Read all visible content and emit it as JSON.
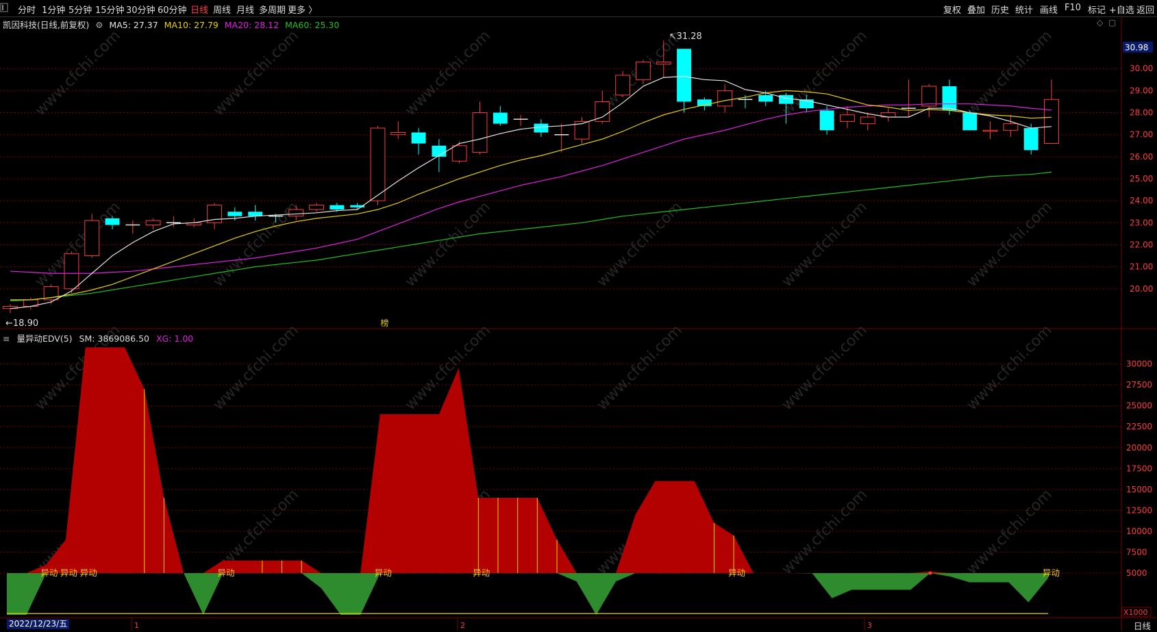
{
  "toolbar": {
    "periods": [
      "分时",
      "1分钟",
      "5分钟",
      "15分钟",
      "30分钟",
      "60分钟",
      "日线",
      "周线",
      "月线",
      "多周期",
      "更多 〉"
    ],
    "active_period": "日线",
    "right_buttons": [
      "复权",
      "叠加",
      "历史",
      "统计",
      "画线",
      "F10",
      "标记",
      "+自选",
      "返回"
    ]
  },
  "info": {
    "stock": "凯因科技(日线,前复权)",
    "ma5": "MA5: 27.37",
    "ma10": "MA10: 27.79",
    "ma20": "MA20: 28.12",
    "ma60": "MA60: 25.30"
  },
  "colors": {
    "up": "#ff3b3b",
    "down": "#00ffff",
    "ma5": "#e6e6e6",
    "ma10": "#e8d200",
    "ma20": "#e020e0",
    "ma60": "#20c020",
    "area_up": "#b30000",
    "area_down": "#2e8b2e",
    "grid": "#7a0000"
  },
  "price_axis": {
    "current_price": "30.98",
    "ticks": [
      "30.00",
      "29.00",
      "28.00",
      "27.00",
      "26.00",
      "25.00",
      "24.00",
      "23.00",
      "22.00",
      "21.00",
      "20.00"
    ],
    "high_label": "31.28",
    "low_label": "18.90"
  },
  "indicator": {
    "name": "量异动EDV(5)",
    "sm": "SM: 3869086.50",
    "xg": "XG: 1.00",
    "ticks": [
      "30000",
      "27500",
      "25000",
      "22500",
      "20000",
      "17500",
      "15000",
      "12500",
      "10000",
      "7500",
      "5000"
    ],
    "unit": "X1000",
    "signal_label": "异动",
    "event_label": "榜"
  },
  "bottom": {
    "date": "2022/12/23/五",
    "month_marks": [
      "1",
      "2",
      "3"
    ],
    "period": "日线"
  },
  "chart_data": {
    "type": "candlestick",
    "candles": [
      [
        19.1,
        19.2,
        19.3,
        18.9,
        "up"
      ],
      [
        19.2,
        19.5,
        19.6,
        19.05,
        "up"
      ],
      [
        19.5,
        20.1,
        20.2,
        19.3,
        "up"
      ],
      [
        20.0,
        21.6,
        21.7,
        19.8,
        "up"
      ],
      [
        21.5,
        23.1,
        23.4,
        21.4,
        "up"
      ],
      [
        23.2,
        22.9,
        23.3,
        22.7,
        "down"
      ],
      [
        22.9,
        22.9,
        23.1,
        22.5,
        "flat"
      ],
      [
        22.9,
        23.1,
        23.2,
        22.7,
        "up"
      ],
      [
        23.0,
        23.0,
        23.3,
        22.8,
        "flat"
      ],
      [
        22.9,
        23.0,
        23.2,
        22.8,
        "up"
      ],
      [
        23.0,
        23.8,
        23.9,
        22.7,
        "up"
      ],
      [
        23.5,
        23.3,
        23.7,
        23.1,
        "down"
      ],
      [
        23.5,
        23.3,
        23.8,
        23.1,
        "down"
      ],
      [
        23.3,
        23.2,
        23.4,
        23.0,
        "flat"
      ],
      [
        23.3,
        23.6,
        23.8,
        23.1,
        "up"
      ],
      [
        23.6,
        23.8,
        23.9,
        23.5,
        "up"
      ],
      [
        23.8,
        23.6,
        23.9,
        23.5,
        "down"
      ],
      [
        23.8,
        23.7,
        23.9,
        23.6,
        "down"
      ],
      [
        24.0,
        27.3,
        27.4,
        23.8,
        "up"
      ],
      [
        27.0,
        27.1,
        27.6,
        26.8,
        "up"
      ],
      [
        27.1,
        26.6,
        27.3,
        26.1,
        "down"
      ],
      [
        26.5,
        26.0,
        26.8,
        25.3,
        "down"
      ],
      [
        25.8,
        26.5,
        26.7,
        25.7,
        "up"
      ],
      [
        26.2,
        28.0,
        28.5,
        26.1,
        "up"
      ],
      [
        28.0,
        27.5,
        28.3,
        27.4,
        "down"
      ],
      [
        27.7,
        27.7,
        27.9,
        27.4,
        "flat"
      ],
      [
        27.5,
        27.1,
        27.7,
        26.9,
        "down"
      ],
      [
        27.0,
        27.0,
        27.5,
        26.2,
        "flat"
      ],
      [
        26.8,
        27.6,
        27.8,
        26.6,
        "up"
      ],
      [
        27.6,
        28.5,
        29.0,
        27.5,
        "up"
      ],
      [
        28.8,
        29.7,
        29.9,
        28.7,
        "up"
      ],
      [
        29.5,
        30.3,
        30.4,
        29.3,
        "up"
      ],
      [
        30.3,
        30.2,
        31.28,
        29.6,
        "up"
      ],
      [
        30.9,
        28.5,
        30.9,
        28.0,
        "down"
      ],
      [
        28.6,
        28.3,
        28.7,
        28.1,
        "down"
      ],
      [
        28.3,
        29.0,
        29.3,
        28.0,
        "up"
      ],
      [
        28.6,
        28.5,
        28.8,
        28.2,
        "flat"
      ],
      [
        28.8,
        28.5,
        29.0,
        28.3,
        "down"
      ],
      [
        28.8,
        28.4,
        28.9,
        27.5,
        "down"
      ],
      [
        28.6,
        28.2,
        28.8,
        28.0,
        "down"
      ],
      [
        28.1,
        27.2,
        28.3,
        27.0,
        "down"
      ],
      [
        27.6,
        27.9,
        28.3,
        27.3,
        "up"
      ],
      [
        27.5,
        27.8,
        28.0,
        27.2,
        "up"
      ],
      [
        27.8,
        28.0,
        28.2,
        27.6,
        "up"
      ],
      [
        28.2,
        28.2,
        29.5,
        27.8,
        "flat"
      ],
      [
        28.3,
        29.2,
        29.3,
        27.8,
        "up"
      ],
      [
        29.2,
        28.1,
        29.5,
        27.9,
        "down"
      ],
      [
        28.0,
        27.2,
        28.1,
        27.2,
        "down"
      ],
      [
        27.2,
        27.2,
        27.6,
        26.8,
        "up"
      ],
      [
        27.2,
        27.5,
        27.9,
        26.9,
        "up"
      ],
      [
        27.3,
        26.3,
        27.5,
        26.1,
        "down"
      ],
      [
        26.6,
        28.6,
        29.5,
        26.6,
        "up"
      ]
    ],
    "ma5": [
      19.1,
      19.2,
      19.4,
      19.9,
      20.7,
      21.5,
      22.1,
      22.6,
      22.95,
      23.0,
      23.15,
      23.2,
      23.3,
      23.35,
      23.4,
      23.45,
      23.55,
      23.6,
      24.25,
      24.9,
      25.5,
      26.05,
      26.6,
      26.8,
      27.05,
      27.25,
      27.35,
      27.4,
      27.5,
      27.8,
      28.45,
      29.2,
      29.6,
      29.65,
      29.5,
      29.45,
      29.05,
      28.9,
      28.65,
      28.55,
      28.35,
      28.15,
      27.95,
      27.8,
      27.8,
      28.2,
      28.2,
      28.0,
      27.85,
      27.6,
      27.3,
      27.37
    ],
    "ma10": [
      19.5,
      19.5,
      19.6,
      19.75,
      19.95,
      20.2,
      20.55,
      20.9,
      21.25,
      21.6,
      21.95,
      22.3,
      22.6,
      22.85,
      23.05,
      23.2,
      23.3,
      23.4,
      23.6,
      23.9,
      24.3,
      24.65,
      25.0,
      25.3,
      25.6,
      25.85,
      26.05,
      26.3,
      26.55,
      26.8,
      27.15,
      27.55,
      27.9,
      28.15,
      28.35,
      28.55,
      28.7,
      28.9,
      29.0,
      28.95,
      28.85,
      28.6,
      28.35,
      28.25,
      28.1,
      28.15,
      28.1,
      28.0,
      27.9,
      27.85,
      27.75,
      27.79
    ],
    "ma20": [
      20.8,
      20.75,
      20.7,
      20.7,
      20.7,
      20.75,
      20.8,
      20.9,
      21.0,
      21.1,
      21.2,
      21.3,
      21.4,
      21.55,
      21.7,
      21.85,
      22.05,
      22.25,
      22.6,
      22.95,
      23.3,
      23.65,
      23.95,
      24.2,
      24.45,
      24.7,
      24.9,
      25.1,
      25.35,
      25.6,
      25.9,
      26.2,
      26.5,
      26.8,
      27.0,
      27.2,
      27.45,
      27.7,
      27.9,
      28.05,
      28.15,
      28.25,
      28.3,
      28.35,
      28.35,
      28.4,
      28.4,
      28.4,
      28.35,
      28.3,
      28.2,
      28.12
    ],
    "ma60": [
      19.45,
      19.5,
      19.6,
      19.7,
      19.8,
      19.95,
      20.1,
      20.25,
      20.4,
      20.55,
      20.7,
      20.85,
      21.0,
      21.1,
      21.2,
      21.3,
      21.45,
      21.6,
      21.75,
      21.9,
      22.05,
      22.2,
      22.35,
      22.5,
      22.6,
      22.7,
      22.8,
      22.9,
      23.0,
      23.15,
      23.3,
      23.4,
      23.5,
      23.6,
      23.7,
      23.8,
      23.9,
      24.0,
      24.1,
      24.2,
      24.3,
      24.4,
      24.5,
      24.6,
      24.7,
      24.8,
      24.9,
      25.0,
      25.1,
      25.15,
      25.2,
      25.3
    ],
    "edv": [
      4.4,
      4.4,
      6000,
      9000,
      32000,
      32000,
      32000,
      27000,
      14000,
      5000,
      0,
      6500,
      6500,
      6500,
      6500,
      6500,
      3200,
      0,
      0,
      24000,
      24000,
      24000,
      24000,
      29500,
      14000,
      14000,
      14000,
      14000,
      9000,
      4000,
      0,
      4000,
      12000,
      16000,
      16000,
      16000,
      11000,
      9500,
      5000,
      5000,
      5000,
      4950,
      2000,
      3000,
      3000,
      3000,
      3000,
      5200,
      4600,
      3900,
      3900,
      3900,
      1500,
      4400
    ],
    "edv_baseline": 5000,
    "y_ylim": [
      0,
      33000
    ],
    "price_ylim": [
      18.5,
      31.5
    ]
  }
}
